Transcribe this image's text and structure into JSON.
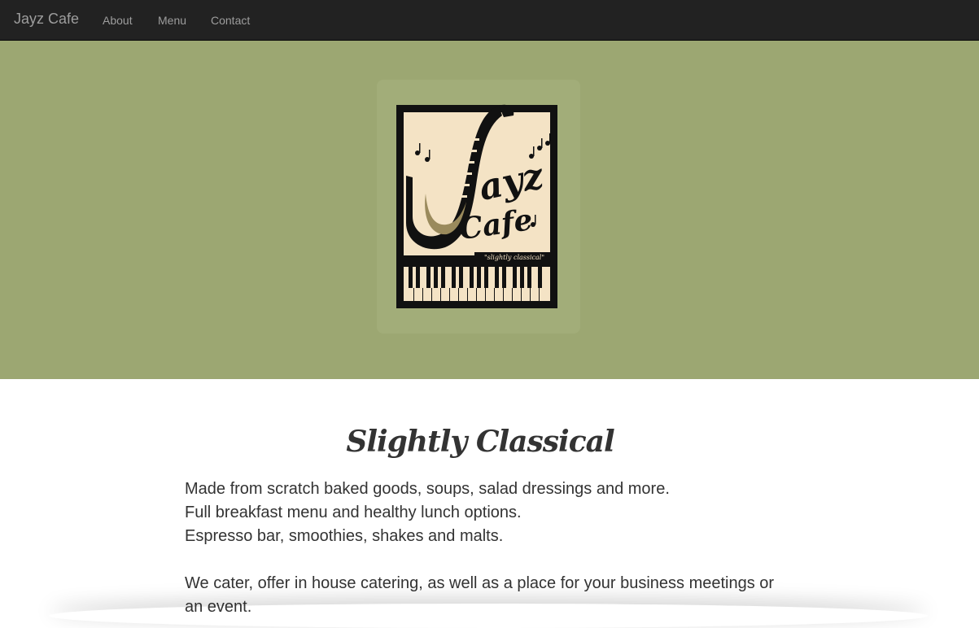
{
  "navbar": {
    "brand": "Jayz Cafe",
    "items": [
      {
        "label": "About"
      },
      {
        "label": "Menu"
      },
      {
        "label": "Contact"
      }
    ]
  },
  "hero": {
    "logo": {
      "wordmark": "Jayz Cafe",
      "tagline": "\"slightly classical\""
    }
  },
  "main": {
    "heading": "Slightly Classical",
    "lines": [
      "Made from scratch baked goods, soups, salad dressings and more.",
      "Full breakfast menu and healthy lunch options.",
      "Espresso bar, smoothies, shakes and malts."
    ],
    "catering": "We cater, offer in house catering, as well as a place for your business meetings or an event."
  },
  "colors": {
    "navbar_bg": "#222222",
    "nav_text": "#9d9d9d",
    "hero_bg": "#9ca772",
    "logo_cream": "#f4e3c5",
    "text": "#333333"
  }
}
